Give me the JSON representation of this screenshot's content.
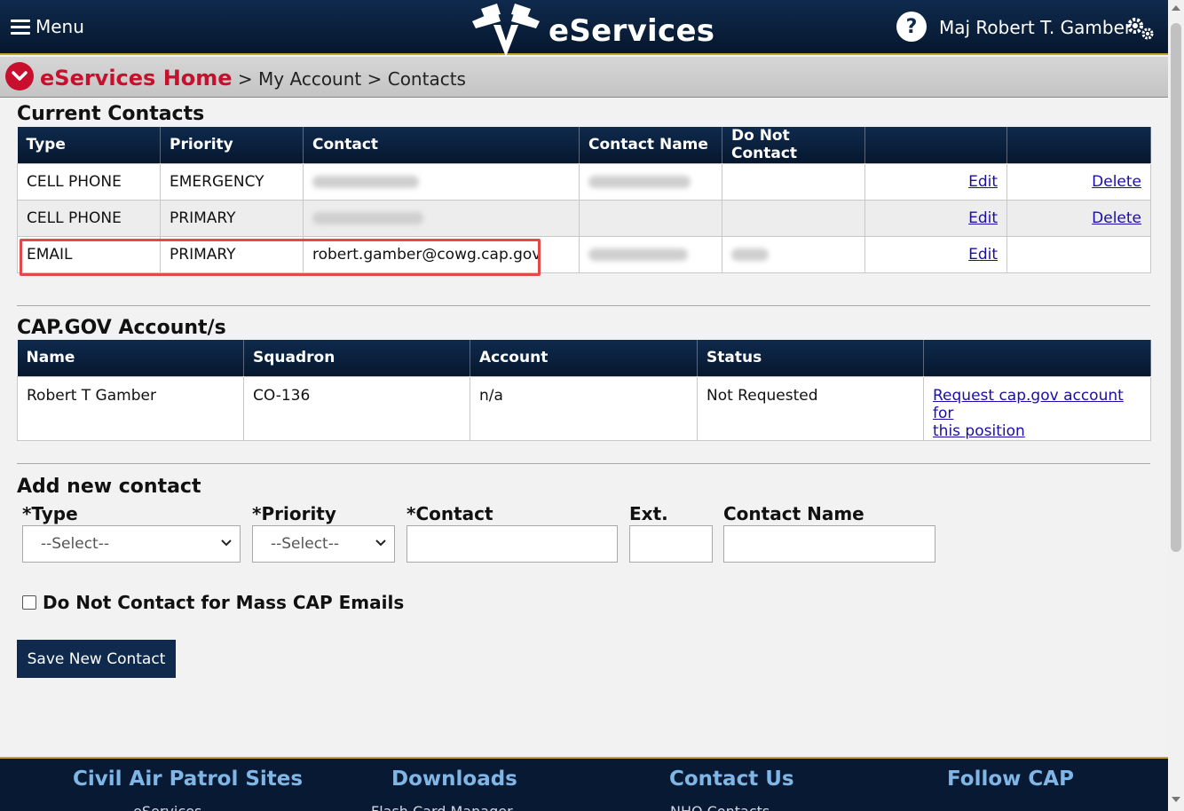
{
  "header": {
    "menu_label": "Menu",
    "brand": "eServices",
    "help": "?",
    "user": "Maj Robert T. Gamber"
  },
  "breadcrumb": {
    "home": "eServices Home",
    "sep": ">",
    "account": "My Account",
    "current": "Contacts"
  },
  "current_contacts": {
    "title": "Current Contacts",
    "headers": [
      "Type",
      "Priority",
      "Contact",
      "Contact Name",
      "Do Not Contact",
      "",
      ""
    ],
    "rows": [
      {
        "type": "CELL PHONE",
        "priority": "EMERGENCY",
        "contact": "",
        "name": "",
        "dnc": "",
        "edit": "Edit",
        "delete": "Delete"
      },
      {
        "type": "CELL PHONE",
        "priority": "PRIMARY",
        "contact": "",
        "name": "",
        "dnc": "",
        "edit": "Edit",
        "delete": "Delete"
      },
      {
        "type": "EMAIL",
        "priority": "PRIMARY",
        "contact": "robert.gamber@cowg.cap.gov",
        "name": "",
        "dnc": "",
        "edit": "Edit",
        "delete": ""
      }
    ]
  },
  "capgov": {
    "title": "CAP.GOV Account/s",
    "headers": [
      "Name",
      "Squadron",
      "Account",
      "Status",
      ""
    ],
    "rows": [
      {
        "name": "Robert T Gamber",
        "squadron": "CO-136",
        "account": "n/a",
        "status": "Not Requested",
        "action_line1": "Request cap.gov account for",
        "action_line2": "this position"
      }
    ]
  },
  "add_contact": {
    "title": "Add new contact",
    "type_label": "*Type",
    "type_value": "--Select--",
    "priority_label": "*Priority",
    "priority_value": "--Select--",
    "contact_label": "*Contact",
    "ext_label": "Ext.",
    "name_label": "Contact Name",
    "dnc_label": "Do Not Contact for Mass CAP Emails",
    "save_label": "Save New Contact"
  },
  "footer": {
    "col1": "Civil Air Patrol Sites",
    "col1_sub": "eServices",
    "col2": "Downloads",
    "col2_sub": "Flash Card Manager",
    "col3": "Contact Us",
    "col3_sub": "NHQ Contacts",
    "col4": "Follow CAP"
  },
  "colors": {
    "navy": "#0f2a4d",
    "brand_red": "#c8102e",
    "gold": "#c9a227",
    "link": "#1a0dab",
    "highlight": "#e04a4a"
  },
  "icons": {
    "menu": "hamburger-icon",
    "logo": "cap-wings-logo-icon",
    "help": "help-icon",
    "settings": "gears-icon",
    "breadcrumb_toggle": "chevron-down-icon"
  }
}
